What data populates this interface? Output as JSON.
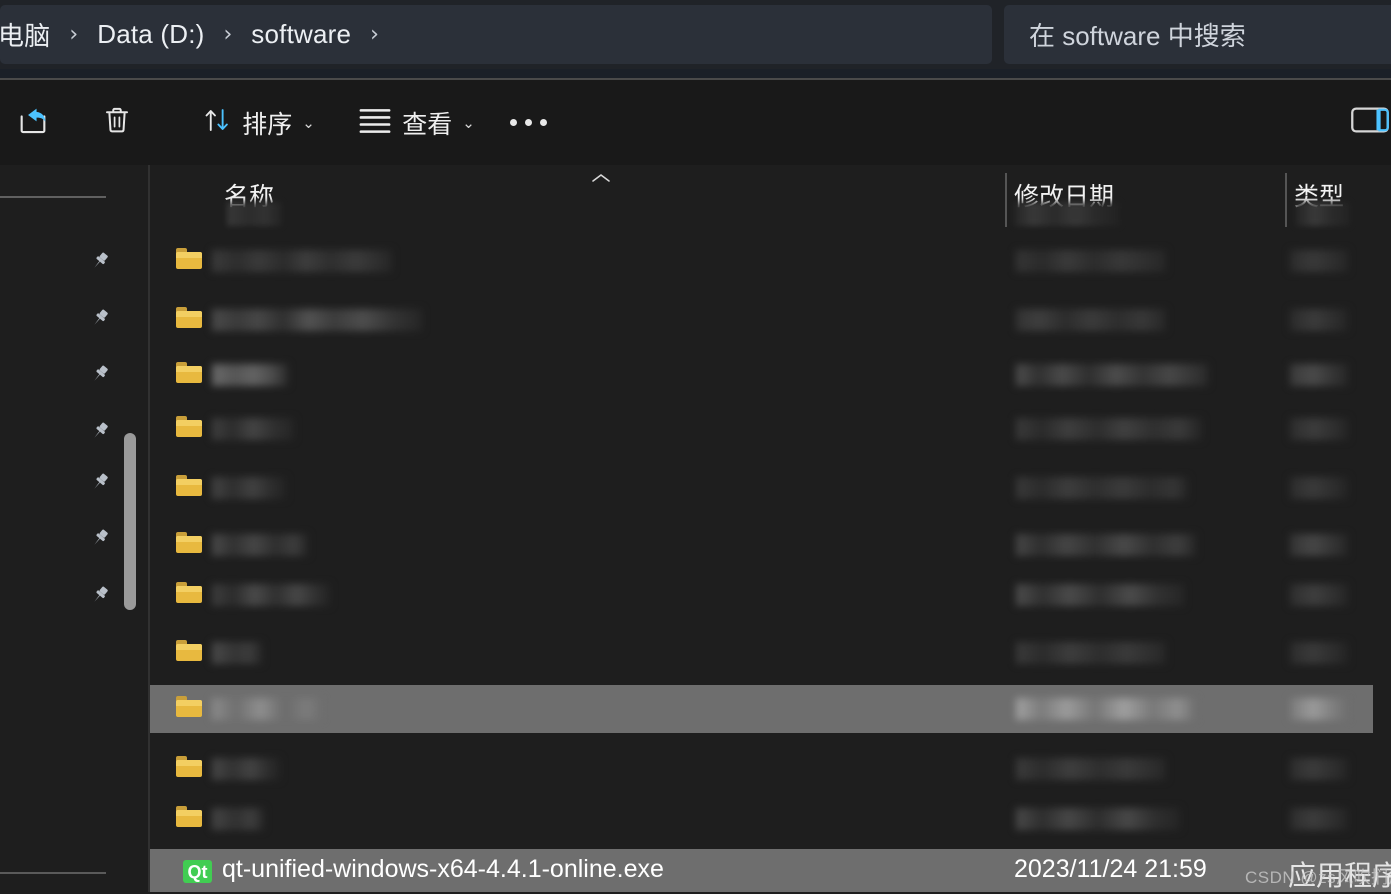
{
  "window": {
    "theme_bg": "#1e1e1e",
    "addressbar_bg": "#2b3039",
    "accent": "#4cc2ff",
    "selection_bg": "#6e6e6e"
  },
  "address": {
    "breadcrumbs": [
      {
        "label": "电脑",
        "name": "breadcrumb-this-pc"
      },
      {
        "label": "Data (D:)",
        "name": "breadcrumb-data-d"
      },
      {
        "label": "software",
        "name": "breadcrumb-software"
      }
    ],
    "separator": "›"
  },
  "search": {
    "placeholder": "在 software 中搜索",
    "value": ""
  },
  "toolbar": {
    "items": [
      {
        "name": "share-button",
        "icon": "share-icon",
        "label": ""
      },
      {
        "name": "delete-button",
        "icon": "trash-icon",
        "label": ""
      },
      {
        "name": "sort-button",
        "icon": "sort-arrows-icon",
        "label": "排序",
        "caret": "⌄"
      },
      {
        "name": "view-button",
        "icon": "hamburger-lines-icon",
        "label": "查看",
        "caret": "⌄"
      },
      {
        "name": "more-options-button",
        "icon": "ellipsis-icon",
        "label": ""
      }
    ],
    "details_pane_toggle": {
      "name": "details-pane-toggle",
      "label": ""
    }
  },
  "sidebar": {
    "pinned_items": [
      {
        "name": "sidebar-pin-1",
        "icon": "pin-icon",
        "label": ""
      },
      {
        "name": "sidebar-pin-2",
        "icon": "pin-icon",
        "label": ""
      },
      {
        "name": "sidebar-pin-3",
        "icon": "pin-icon",
        "label": ""
      },
      {
        "name": "sidebar-pin-4",
        "icon": "pin-icon",
        "label": ""
      },
      {
        "name": "sidebar-pin-5",
        "icon": "pin-icon",
        "label": ""
      },
      {
        "name": "sidebar-pin-6",
        "icon": "pin-icon",
        "label": ""
      },
      {
        "name": "sidebar-pin-7",
        "icon": "pin-icon",
        "label": ""
      }
    ]
  },
  "list": {
    "columns": [
      {
        "key": "name",
        "label": "名称",
        "sorted": "asc",
        "sort_glyph": "⌃"
      },
      {
        "key": "date",
        "label": "修改日期",
        "sorted": ""
      },
      {
        "key": "type",
        "label": "类型",
        "sorted": ""
      }
    ],
    "rows": [
      {
        "name": "",
        "date": "",
        "type": "",
        "icon": "folder-icon",
        "selected": false
      },
      {
        "name": "",
        "date": "",
        "type": "",
        "icon": "folder-icon",
        "selected": false
      },
      {
        "name": "",
        "date": "",
        "type": "",
        "icon": "folder-icon",
        "selected": false
      },
      {
        "name": "",
        "date": "",
        "type": "",
        "icon": "folder-icon",
        "selected": false
      },
      {
        "name": "",
        "date": "",
        "type": "",
        "icon": "folder-icon",
        "selected": false
      },
      {
        "name": "",
        "date": "",
        "type": "",
        "icon": "folder-icon",
        "selected": false
      },
      {
        "name": "",
        "date": "",
        "type": "",
        "icon": "folder-icon",
        "selected": false
      },
      {
        "name": "",
        "date": "",
        "type": "",
        "icon": "folder-icon",
        "selected": false
      },
      {
        "name": "",
        "date": "",
        "type": "",
        "icon": "folder-icon",
        "selected": true
      },
      {
        "name": "",
        "date": "",
        "type": "",
        "icon": "folder-icon",
        "selected": false
      },
      {
        "name": "",
        "date": "",
        "type": "",
        "icon": "folder-icon",
        "selected": false
      }
    ],
    "visible_file": {
      "icon": "qt-icon",
      "icon_label": "Qt",
      "name": "qt-unified-windows-x64-4.4.1-online.exe",
      "date": "2023/11/24 21:59",
      "type": "应用程序",
      "selected": true
    }
  },
  "watermark": {
    "text": "CSDN @zs风吹扪序"
  }
}
